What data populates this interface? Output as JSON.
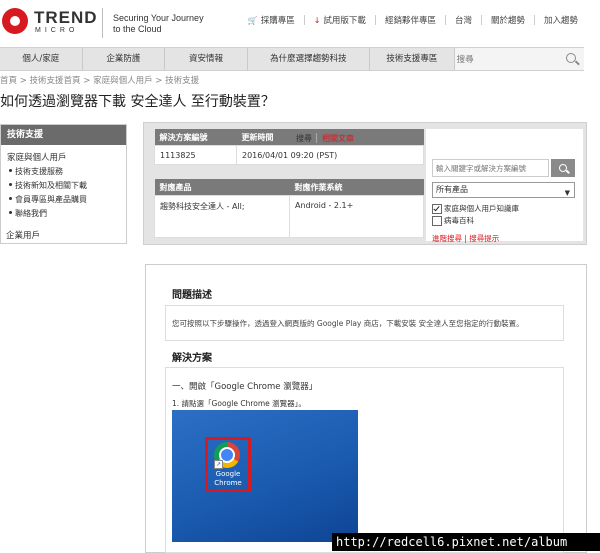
{
  "header": {
    "brand": "TREND",
    "brand_sub": "MICRO",
    "tagline_line1": "Securing Your Journey",
    "tagline_line2": "to the Cloud",
    "utility_nav": [
      "採購專區",
      "試用版下載",
      "經銷夥伴專區",
      "台灣",
      "關於趨勢",
      "加入趨勢"
    ]
  },
  "main_nav": {
    "items": [
      "個人/家庭",
      "企業防護",
      "資安情報",
      "為什麼選擇趨勢科技",
      "技術支援專區"
    ],
    "search_placeholder": "搜尋"
  },
  "breadcrumb": [
    "首頁",
    "技術支援首頁",
    "家庭與個人用戶",
    "技術支援"
  ],
  "breadcrumb_sep": " > ",
  "page_title": "如何透過瀏覽器下載 安全達人 至行動裝置？",
  "sidebar": {
    "heading": "技術支援",
    "group": "家庭與個人用戶",
    "items": [
      "技術支援服務",
      "技術新知及相關下載",
      "會員專區與產品購買",
      "聯絡我們"
    ],
    "enterprise": "企業用戶"
  },
  "info": {
    "solution_no_label": "解決方案編號",
    "updated_label": "更新時間",
    "solution_no": "1113825",
    "updated": "2016/04/01 09:20 (PST)",
    "product_label": "對應產品",
    "os_label": "對應作業系統",
    "product": "趨勢科技安全達人 - All;",
    "os": "Android - 2.1+"
  },
  "search_panel": {
    "tab_search": "搜尋",
    "tab_related": "相關文章",
    "keyword_placeholder": "輸入關鍵字或解決方案編號",
    "product_select": "所有產品",
    "check_home": "家庭與個人用戶知識庫",
    "check_virus": "病毒百科",
    "advanced": "進階搜尋",
    "tips": "搜尋提示",
    "links_sep": " | "
  },
  "article": {
    "desc_heading": "問題描述",
    "desc_text": "您可按照以下步驟操作，透過登入網頁版的 Google Play 商店，下載安裝 安全達人至您指定的行動裝置。",
    "solution_heading": "解決方案",
    "step1": "一、開啟「Google Chrome 瀏覽器」",
    "step1_1": "1. 請點選「Google Chrome 瀏覽器」。",
    "icon_label": "Google Chrome"
  },
  "watermark": "http://redcell6.pixnet.net/album",
  "colors": {
    "brand_red": "#d71920",
    "nav_bg": "#e4e4e4",
    "table_head": "#7a7a7a"
  }
}
